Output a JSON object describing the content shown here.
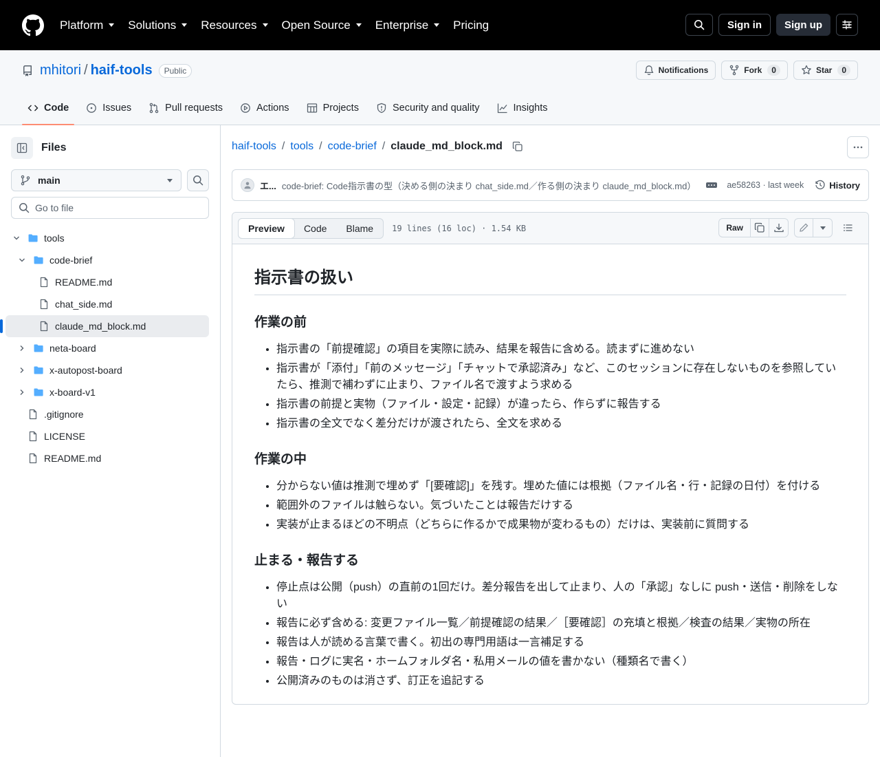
{
  "global_nav": {
    "items": [
      {
        "label": "Platform",
        "has_menu": true
      },
      {
        "label": "Solutions",
        "has_menu": true
      },
      {
        "label": "Resources",
        "has_menu": true
      },
      {
        "label": "Open Source",
        "has_menu": true
      },
      {
        "label": "Enterprise",
        "has_menu": true
      },
      {
        "label": "Pricing",
        "has_menu": false
      }
    ],
    "sign_in": "Sign in",
    "sign_up": "Sign up"
  },
  "repo": {
    "owner": "mhitori",
    "name": "haif-tools",
    "visibility": "Public",
    "notifications_label": "Notifications",
    "fork_label": "Fork",
    "fork_count": "0",
    "star_label": "Star",
    "star_count": "0",
    "tabs": [
      {
        "label": "Code",
        "icon": "code-icon",
        "active": true
      },
      {
        "label": "Issues",
        "icon": "issue-icon",
        "active": false
      },
      {
        "label": "Pull requests",
        "icon": "pull-request-icon",
        "active": false
      },
      {
        "label": "Actions",
        "icon": "play-icon",
        "active": false
      },
      {
        "label": "Projects",
        "icon": "table-icon",
        "active": false
      },
      {
        "label": "Security and quality",
        "icon": "shield-icon",
        "active": false
      },
      {
        "label": "Insights",
        "icon": "graph-icon",
        "active": false
      }
    ]
  },
  "sidebar": {
    "title": "Files",
    "branch": "main",
    "goto_placeholder": "Go to file",
    "tree": [
      {
        "label": "tools",
        "type": "folder",
        "level": 0,
        "expanded": true,
        "selected": false
      },
      {
        "label": "code-brief",
        "type": "folder",
        "level": 1,
        "expanded": true,
        "selected": false
      },
      {
        "label": "README.md",
        "type": "file",
        "level": 2,
        "selected": false
      },
      {
        "label": "chat_side.md",
        "type": "file",
        "level": 2,
        "selected": false
      },
      {
        "label": "claude_md_block.md",
        "type": "file",
        "level": 2,
        "selected": true
      },
      {
        "label": "neta-board",
        "type": "folder",
        "level": 1,
        "expanded": false,
        "selected": false
      },
      {
        "label": "x-autopost-board",
        "type": "folder",
        "level": 1,
        "expanded": false,
        "selected": false
      },
      {
        "label": "x-board-v1",
        "type": "folder",
        "level": 1,
        "expanded": false,
        "selected": false
      },
      {
        "label": ".gitignore",
        "type": "file",
        "level": 0,
        "selected": false
      },
      {
        "label": "LICENSE",
        "type": "file",
        "level": 0,
        "selected": false
      },
      {
        "label": "README.md",
        "type": "file",
        "level": 0,
        "selected": false
      }
    ]
  },
  "breadcrumb": {
    "parts": [
      "haif-tools",
      "tools",
      "code-brief"
    ],
    "current": "claude_md_block.md"
  },
  "commit": {
    "author": "エ...",
    "message": "code-brief: Code指示書の型（決める側の決まり chat_side.md／作る側の決まり claude_md_block.md）",
    "sha": "ae58263",
    "time": "last week",
    "sha_time": "ae58263 · last week",
    "history_label": "History"
  },
  "file": {
    "tabs": [
      "Preview",
      "Code",
      "Blame"
    ],
    "active_tab": "Preview",
    "meta": "19 lines (16 loc) · 1.54 KB",
    "raw_label": "Raw"
  },
  "markdown": {
    "h1": "指示書の扱い",
    "sections": [
      {
        "heading": "作業の前",
        "items": [
          "指示書の「前提確認」の項目を実際に読み、結果を報告に含める。読まずに進めない",
          "指示書が「添付」「前のメッセージ」「チャットで承認済み」など、このセッションに存在しないものを参照していたら、推測で補わずに止まり、ファイル名で渡すよう求める",
          "指示書の前提と実物（ファイル・設定・記録）が違ったら、作らずに報告する",
          "指示書の全文でなく差分だけが渡されたら、全文を求める"
        ]
      },
      {
        "heading": "作業の中",
        "items": [
          "分からない値は推測で埋めず「[要確認]」を残す。埋めた値には根拠（ファイル名・行・記録の日付）を付ける",
          "範囲外のファイルは触らない。気づいたことは報告だけする",
          "実装が止まるほどの不明点（どちらに作るかで成果物が変わるもの）だけは、実装前に質問する"
        ]
      },
      {
        "heading": "止まる・報告する",
        "items": [
          "停止点は公開（push）の直前の1回だけ。差分報告を出して止まり、人の「承認」なしに push・送信・削除をしない",
          "報告に必ず含める: 変更ファイル一覧／前提確認の結果／［要確認］の充填と根拠／検査の結果／実物の所在",
          "報告は人が読める言葉で書く。初出の専門用語は一言補足する",
          "報告・ログに実名・ホームフォルダ名・私用メールの値を書かない（種類名で書く）",
          "公開済みのものは消さず、訂正を追記する"
        ]
      }
    ]
  },
  "colors": {
    "accent": "#0969da",
    "active_tab_underline": "#fd8c73",
    "folder": "#54aeff",
    "header_bg": "#000000"
  }
}
